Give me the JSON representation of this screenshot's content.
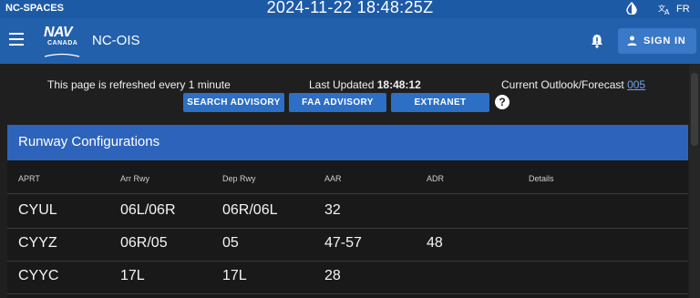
{
  "sysbar": {
    "app_name": "NC-SPACES",
    "clock": "2024-11-22  18:48:25Z",
    "lang": "FR"
  },
  "appbar": {
    "logo_top": "NAV",
    "logo_bottom": "CANADA",
    "title": "NC-OIS",
    "signin_label": "SIGN IN"
  },
  "info": {
    "refresh": "This page is refreshed every 1 minute",
    "updated_label": "Last Updated",
    "updated_time": "18:48:12",
    "outlook_label": "Current Outlook/Forecast",
    "outlook_link": "005"
  },
  "buttons": {
    "search": "SEARCH ADVISORY",
    "faa": "FAA ADVISORY",
    "extranet": "EXTRANET",
    "help": "?"
  },
  "runway": {
    "title": "Runway Configurations",
    "headers": [
      "APRT",
      "Arr Rwy",
      "Dep Rwy",
      "AAR",
      "ADR",
      "Details"
    ],
    "rows": [
      {
        "aprt": "CYUL",
        "arr": "06L/06R",
        "dep": "06R/06L",
        "aar": "32",
        "adr": "",
        "details": ""
      },
      {
        "aprt": "CYYZ",
        "arr": "06R/05",
        "dep": "05",
        "aar": "47-57",
        "adr": "48",
        "details": ""
      },
      {
        "aprt": "CYYC",
        "arr": "17L",
        "dep": "17L",
        "aar": "28",
        "adr": "",
        "details": ""
      }
    ]
  },
  "colors": {
    "sysbar": "#1d5aa6",
    "appbar": "#2360ab",
    "button": "#2d6fc4",
    "panel_header": "#2d63ba",
    "link": "#6aa3e8"
  }
}
